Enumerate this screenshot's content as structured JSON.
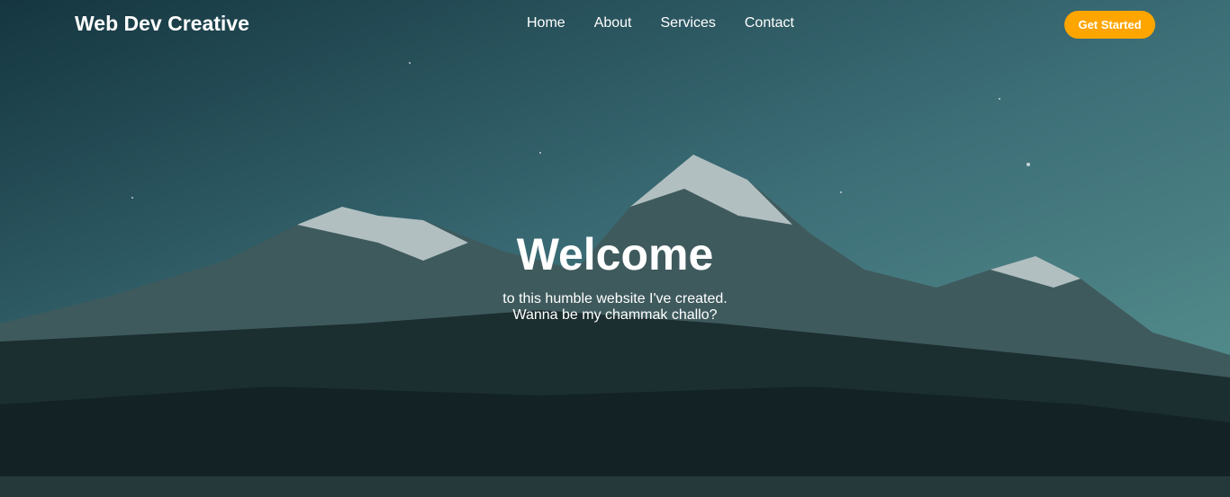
{
  "brand": "Web Dev Creative",
  "nav": {
    "links": [
      "Home",
      "About",
      "Services",
      "Contact"
    ],
    "cta": "Get Started"
  },
  "hero": {
    "title": "Welcome",
    "line1": "to this humble website I've created.",
    "line2": "Wanna be my chammak challo?"
  },
  "colors": {
    "accent": "#ffa500",
    "sky": "#3f7a80"
  }
}
